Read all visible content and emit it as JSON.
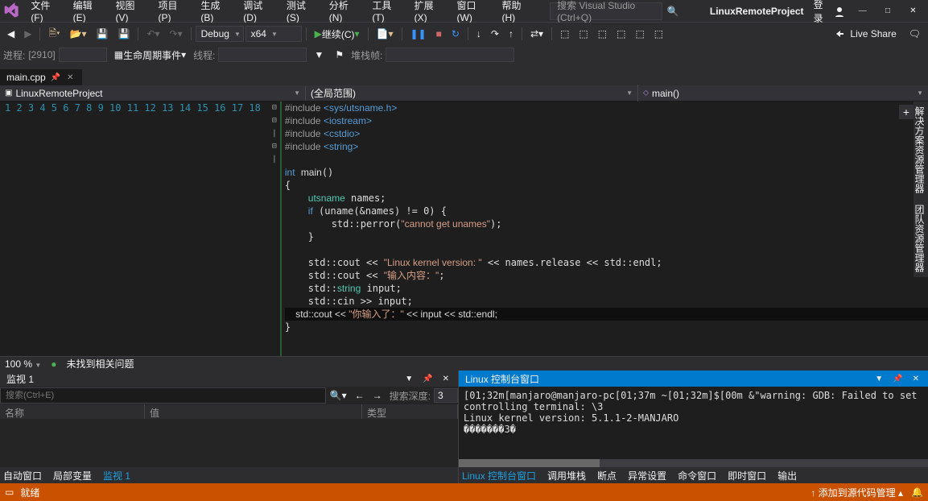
{
  "menu": {
    "file": "文件(F)",
    "edit": "编辑(E)",
    "view": "视图(V)",
    "project": "项目(P)",
    "build": "生成(B)",
    "debug": "调试(D)",
    "test": "测试(S)",
    "analyze": "分析(N)",
    "tools": "工具(T)",
    "extensions": "扩展(X)",
    "window": "窗口(W)",
    "help": "帮助(H)"
  },
  "search": {
    "placeholder": "搜索 Visual Studio (Ctrl+Q)"
  },
  "project_name": "LinuxRemoteProject",
  "login": "登录",
  "toolbar": {
    "config": "Debug",
    "platform": "x64",
    "continue": "继续(C)",
    "live_share": "Live Share"
  },
  "toolbar2": {
    "process": "进程:",
    "process_value": "[2910]",
    "lifecycle": "生命周期事件",
    "thread": "线程:",
    "stackframe": "堆栈帧:"
  },
  "tab": {
    "name": "main.cpp"
  },
  "nav": {
    "scope1": "LinuxRemoteProject",
    "scope2": "(全局范围)",
    "scope3": "main()"
  },
  "code_lines": [
    {
      "n": 1,
      "f": "⊟",
      "html": "<span class='pp'>#include </span><span class='inc'>&lt;sys/utsname.h&gt;</span>"
    },
    {
      "n": 2,
      "f": "",
      "html": "<span class='pp'>#include </span><span class='inc'>&lt;iostream&gt;</span>"
    },
    {
      "n": 3,
      "f": "",
      "html": "<span class='pp'>#include </span><span class='inc'>&lt;cstdio&gt;</span>"
    },
    {
      "n": 4,
      "f": "",
      "html": "<span class='pp'>#include </span><span class='inc'>&lt;string&gt;</span>"
    },
    {
      "n": 5,
      "f": "",
      "html": ""
    },
    {
      "n": 6,
      "f": "⊟",
      "html": "<span class='kw'>int</span> <span class='n'>main</span>()"
    },
    {
      "n": 7,
      "f": "",
      "html": "{"
    },
    {
      "n": 8,
      "f": "|",
      "html": "    <span class='t'>utsname</span> names;"
    },
    {
      "n": 9,
      "f": "⊟",
      "html": "    <span class='kw'>if</span> (uname(&amp;names) != 0) {"
    },
    {
      "n": 10,
      "f": "|",
      "html": "        std::perror(<span class='str'>\"cannot get unames\"</span>);"
    },
    {
      "n": 11,
      "f": "",
      "html": "    }"
    },
    {
      "n": 12,
      "f": "",
      "html": ""
    },
    {
      "n": 13,
      "f": "",
      "html": "    std::cout &lt;&lt; <span class='str'>\"Linux kernel version: \"</span> &lt;&lt; names.release &lt;&lt; std::endl;"
    },
    {
      "n": 14,
      "f": "",
      "html": "    std::cout &lt;&lt; <span class='str'>\"输入内容：\"</span>;"
    },
    {
      "n": 15,
      "f": "",
      "html": "    std::<span class='t'>string</span> input;"
    },
    {
      "n": 16,
      "f": "",
      "html": "    std::cin &gt;&gt; input;"
    },
    {
      "n": 17,
      "f": "",
      "html": "    std::cout &lt;&lt; <span class='str'>\"你输入了：\"</span> &lt;&lt; input &lt;&lt; std::endl;",
      "hl": true
    },
    {
      "n": 18,
      "f": "",
      "html": "}"
    }
  ],
  "side_tabs": {
    "solution": "解决方案资源管理器",
    "team": "团队资源管理器"
  },
  "editor_status": {
    "zoom": "100 %",
    "issues": "未找到相关问题"
  },
  "panel_left": {
    "title": "监视 1",
    "search_placeholder": "搜索(Ctrl+E)",
    "depth_label": "搜索深度:",
    "depth_value": "3",
    "col_name": "名称",
    "col_value": "值",
    "col_type": "类型"
  },
  "panel_right": {
    "title": "Linux 控制台窗口",
    "output": "[01;32m[manjaro@manjaro-pc[01;37m ~[01;32m]$[00m &\"warning: GDB: Failed to set controlling terminal: \\3\nLinux kernel version: 5.1.1-2-MANJARO\n�������3�"
  },
  "bottom_tabs_left": {
    "auto": "自动窗口",
    "locals": "局部变量",
    "watch": "监视 1"
  },
  "bottom_tabs_right": {
    "console": "Linux 控制台窗口",
    "callstack": "调用堆栈",
    "breakpoints": "断点",
    "exceptions": "异常设置",
    "command": "命令窗口",
    "immediate": "即时窗口",
    "output": "输出"
  },
  "statusbar": {
    "state": "就绪",
    "source": "添加到源代码管理"
  }
}
